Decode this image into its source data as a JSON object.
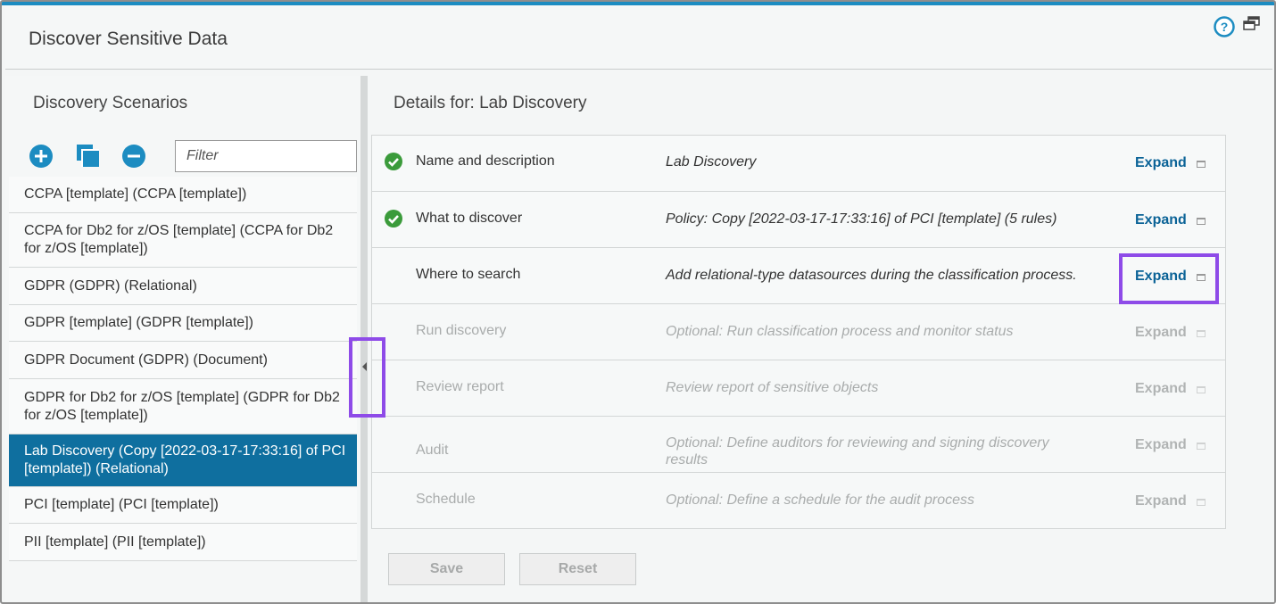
{
  "window": {
    "title": "Discover Sensitive Data",
    "help_icon": "help-icon",
    "restore_icon": "window-restore-icon"
  },
  "scenarios": {
    "title": "Discovery Scenarios",
    "toolbar": {
      "add_icon": "plus-circle-icon",
      "copy_icon": "copy-icon",
      "remove_icon": "minus-circle-icon"
    },
    "filter_placeholder": "Filter",
    "items": [
      {
        "label": "CCPA [template] (CCPA [template])",
        "selected": false
      },
      {
        "label": "CCPA for Db2 for z/OS [template] (CCPA for Db2 for z/OS [template])",
        "selected": false
      },
      {
        "label": "GDPR (GDPR) (Relational)",
        "selected": false
      },
      {
        "label": "GDPR [template] (GDPR [template])",
        "selected": false
      },
      {
        "label": "GDPR Document (GDPR) (Document)",
        "selected": false
      },
      {
        "label": "GDPR for Db2 for z/OS [template] (GDPR for Db2 for z/OS [template])",
        "selected": false
      },
      {
        "label": "Lab Discovery (Copy [2022-03-17-17:33:16] of PCI [template]) (Relational)",
        "selected": true
      },
      {
        "label": "PCI [template] (PCI [template])",
        "selected": false
      },
      {
        "label": "PII [template] (PII [template])",
        "selected": false
      }
    ]
  },
  "details": {
    "title": "Details for: Lab Discovery",
    "steps": [
      {
        "name": "Name and description",
        "description": "Lab Discovery",
        "action": "Expand",
        "completed": true,
        "enabled": true
      },
      {
        "name": "What to discover",
        "description": "Policy: Copy [2022-03-17-17:33:16] of PCI [template] (5 rules)",
        "action": "Expand",
        "completed": true,
        "enabled": true
      },
      {
        "name": "Where to search",
        "description": "Add relational-type datasources during the classification process.",
        "action": "Expand",
        "completed": false,
        "enabled": true
      },
      {
        "name": "Run discovery",
        "description": "Optional: Run classification process and monitor status",
        "action": "Expand",
        "completed": false,
        "enabled": false
      },
      {
        "name": "Review report",
        "description": "Review report of sensitive objects",
        "action": "Expand",
        "completed": false,
        "enabled": false
      },
      {
        "name": "Audit",
        "description": "Optional: Define auditors for reviewing and signing discovery results",
        "action": "Expand",
        "completed": false,
        "enabled": false
      },
      {
        "name": "Schedule",
        "description": "Optional: Define a schedule for the audit process",
        "action": "Expand",
        "completed": false,
        "enabled": false
      }
    ],
    "buttons": {
      "save": "Save",
      "reset": "Reset"
    }
  },
  "colors": {
    "accent": "#1c8cc1",
    "selected_row": "#0f6f9f",
    "link": "#0b6397",
    "success": "#3b9b3b",
    "highlight": "#8e4be8"
  }
}
